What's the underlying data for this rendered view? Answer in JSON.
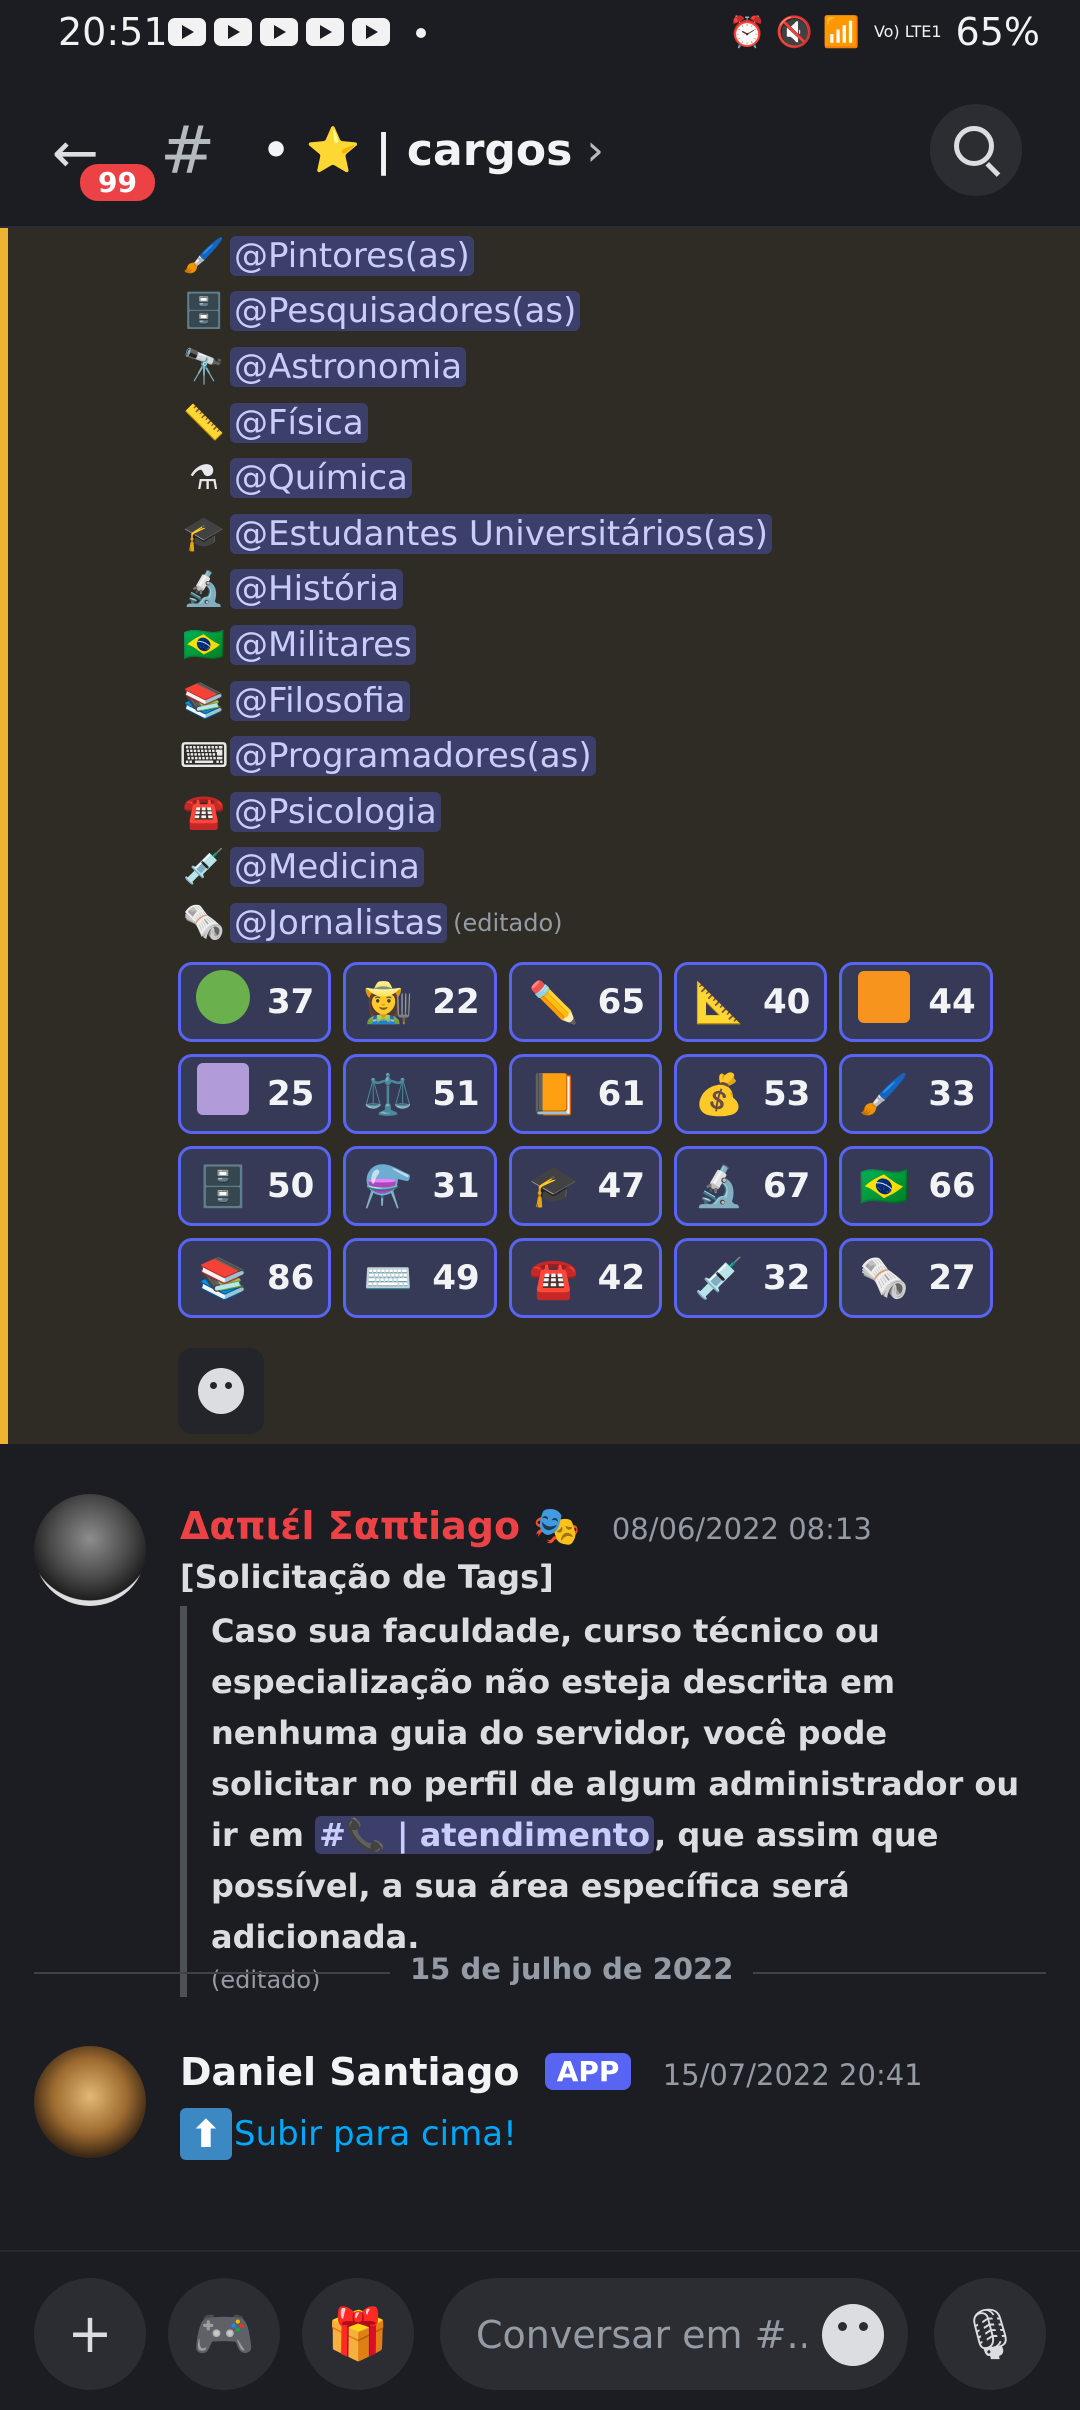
{
  "status_bar": {
    "time": "20:51",
    "icons": [
      "youtube-icon",
      "youtube-icon",
      "youtube-icon",
      "youtube-icon",
      "youtube-icon"
    ],
    "right_icons": "⏰ 🔇 📶",
    "network": "Vo) LTE1",
    "battery": "65%"
  },
  "header": {
    "unread_badge": "99",
    "channel_prefix": "#",
    "channel_name": "• ⭐ | cargos",
    "chevron": "›"
  },
  "pinned_message": {
    "roles": [
      {
        "emoji": "🖌️",
        "label": "@Pintores(as)"
      },
      {
        "emoji": "🗄️",
        "label": "@Pesquisadores(as)"
      },
      {
        "emoji": "🔭",
        "label": "@Astronomia"
      },
      {
        "emoji": "📏",
        "label": "@Física"
      },
      {
        "emoji": "⚗",
        "label": "@Química"
      },
      {
        "emoji": "🎓",
        "label": "@Estudantes Universitários(as)"
      },
      {
        "emoji": "🔬",
        "label": "@História"
      },
      {
        "emoji": "🇧🇷",
        "label": "@Militares"
      },
      {
        "emoji": "📚",
        "label": "@Filosofia"
      },
      {
        "emoji": "⌨",
        "label": "@Programadores(as)"
      },
      {
        "emoji": "☎️",
        "label": "@Psicologia"
      },
      {
        "emoji": "💉",
        "label": "@Medicina"
      },
      {
        "emoji": "🗞️",
        "label": "@Jornalistas"
      }
    ],
    "edited_label": "(editado)",
    "reactions": [
      [
        {
          "emoji": "green-circle",
          "count": "37"
        },
        {
          "emoji": "👩‍🌾",
          "count": "22"
        },
        {
          "emoji": "✏️",
          "count": "65"
        },
        {
          "emoji": "📐",
          "count": "40"
        },
        {
          "emoji": "orange-square",
          "count": "44"
        }
      ],
      [
        {
          "emoji": "purple-square",
          "count": "25"
        },
        {
          "emoji": "⚖️",
          "count": "51"
        },
        {
          "emoji": "📙",
          "count": "61"
        },
        {
          "emoji": "💰",
          "count": "53"
        },
        {
          "emoji": "🖌️",
          "count": "33"
        }
      ],
      [
        {
          "emoji": "🗄️",
          "count": "50"
        },
        {
          "emoji": "⚗️",
          "count": "31"
        },
        {
          "emoji": "🎓",
          "count": "47"
        },
        {
          "emoji": "🔬",
          "count": "67"
        },
        {
          "emoji": "🇧🇷",
          "count": "66"
        }
      ],
      [
        {
          "emoji": "📚",
          "count": "86"
        },
        {
          "emoji": "⌨️",
          "count": "49"
        },
        {
          "emoji": "☎️",
          "count": "42"
        },
        {
          "emoji": "💉",
          "count": "32"
        },
        {
          "emoji": "🗞️",
          "count": "27"
        }
      ]
    ],
    "colors": {
      "green": "#6ab04c",
      "orange": "#f7941d",
      "purple": "#b19cd9"
    }
  },
  "message1": {
    "author": "Δαπιέl Σαπtiagο",
    "author_emoji": "🎭",
    "author_color": "#ed4245",
    "timestamp": "08/06/2022 08:13",
    "heading": "[Solicitação de Tags]",
    "quote_before": "Caso sua faculdade, curso técnico ou especialização não esteja descrita em nenhuma guia do servidor, você pode solicitar no perfil de algum administrador ou ir em ",
    "channel_mention": "#📞 | atendimento",
    "quote_after": ", que assim que possível, a sua área específica será adicionada.",
    "edited_label": "(editado)"
  },
  "date_divider": "15 de julho de 2022",
  "message2": {
    "author": "Daniel Santiago",
    "app_badge": "APP",
    "timestamp": "15/07/2022 20:41",
    "arrow": "⬆",
    "link_text": "Subir para cima!"
  },
  "composer": {
    "add_icon": "+",
    "games_icon": "🎮",
    "gift_icon": "🎁",
    "placeholder": "Conversar em #...",
    "mic_icon": "🎙"
  }
}
